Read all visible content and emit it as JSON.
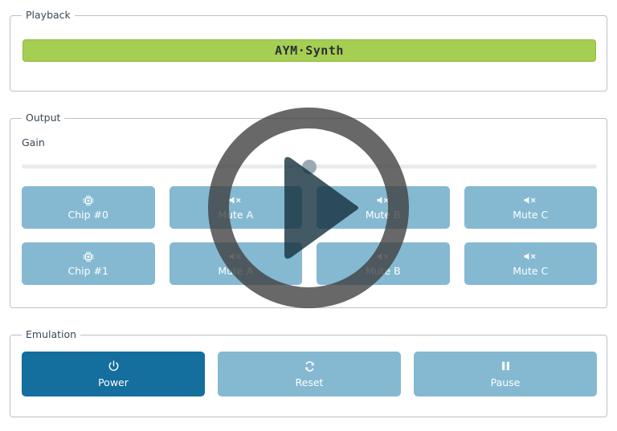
{
  "app": {
    "title": "AYM·Synth"
  },
  "playback": {
    "legend": "Playback",
    "title_button_label": "AYM·Synth"
  },
  "output": {
    "legend": "Output",
    "gain_label": "Gain",
    "gain_value_percent": 50,
    "chips": [
      {
        "label": "Chip #0",
        "icon": "chip-icon"
      },
      {
        "label": "Chip #1",
        "icon": "chip-icon"
      }
    ],
    "mute_buttons": [
      {
        "label": "Mute A",
        "icon": "speaker-mute-icon"
      },
      {
        "label": "Mute B",
        "icon": "speaker-mute-icon"
      },
      {
        "label": "Mute C",
        "icon": "speaker-mute-icon"
      },
      {
        "label": "Mute A",
        "icon": "speaker-mute-icon"
      },
      {
        "label": "Mute B",
        "icon": "speaker-mute-icon"
      },
      {
        "label": "Mute C",
        "icon": "speaker-mute-icon"
      }
    ]
  },
  "emulation": {
    "legend": "Emulation",
    "buttons": [
      {
        "label": "Power",
        "icon": "power-icon",
        "state": "active"
      },
      {
        "label": "Reset",
        "icon": "refresh-icon",
        "state": "normal"
      },
      {
        "label": "Pause",
        "icon": "pause-icon",
        "state": "normal"
      }
    ]
  },
  "overlay": {
    "play_icon": "play-circle-icon"
  },
  "colors": {
    "accent_green": "#a6ce52",
    "button_blue": "#85b9d1",
    "active_blue": "#146e9e",
    "border_gray": "#b9c2c9",
    "track_gray": "#e9ecef",
    "thumb_gray": "#9aa9b4",
    "overlay_dark": "#3d3d3d",
    "text_dark": "#2f3b46"
  }
}
